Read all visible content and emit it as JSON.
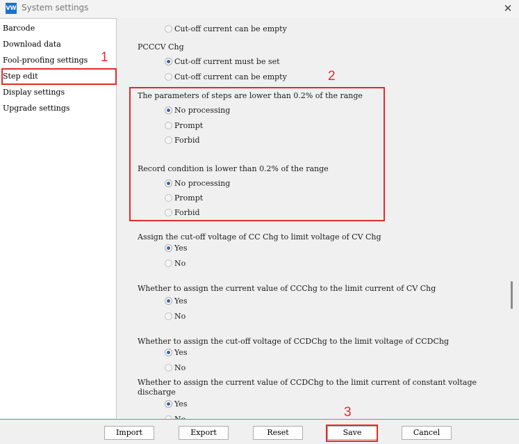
{
  "window": {
    "title": "System settings",
    "icon": "app-logo-icon",
    "close": "close-icon",
    "icon_text": "VW"
  },
  "sidebar": {
    "items": [
      {
        "label": "Barcode"
      },
      {
        "label": "Download data"
      },
      {
        "label": "Fool-proofing settings"
      },
      {
        "label": "Step edit",
        "selected": true
      },
      {
        "label": "Display settings"
      },
      {
        "label": "Upgrade settings"
      }
    ]
  },
  "content": {
    "top_option": "Cut-off current can be empty",
    "pcccv": {
      "heading": "PCCCV Chg",
      "options": [
        "Cut-off current must be set",
        "Cut-off current can be empty"
      ],
      "selected": 0
    },
    "steps_param": {
      "heading": "The parameters of steps are lower than 0.2% of the range",
      "options": [
        "No processing",
        "Prompt",
        "Forbid"
      ],
      "selected": 0
    },
    "record_condition": {
      "heading": "Record condition is lower than 0.2% of the range",
      "options": [
        "No processing",
        "Prompt",
        "Forbid"
      ],
      "selected": 0
    },
    "assign_cc": {
      "heading": "Assign the cut-off voltage of CC Chg to limit voltage of CV Chg",
      "options": [
        "Yes",
        "No"
      ],
      "selected": 0
    },
    "assign_ccchg": {
      "heading": "Whether to assign the current value of CCChg to the limit current of CV Chg",
      "options": [
        "Yes",
        "No"
      ],
      "selected": 0
    },
    "assign_ccdchg_voltage": {
      "heading": "Whether to assign the cut-off voltage of CCDChg to the limit voltage of CCDChg",
      "options": [
        "Yes",
        "No"
      ],
      "selected": 0
    },
    "assign_ccdchg_current": {
      "heading_line1": "Whether to assign the current value of CCDChg to the limit current of constant voltage",
      "heading_line2": "discharge",
      "options": [
        "Yes",
        "No"
      ],
      "selected": 0
    }
  },
  "buttons": {
    "import": "Import",
    "export": "Export",
    "reset": "Reset",
    "save": "Save",
    "cancel": "Cancel"
  },
  "annotations": {
    "mark1": "1",
    "mark2": "2",
    "mark3": "3"
  },
  "colors": {
    "highlight": "#e32a2a",
    "radio_selected": "#3b5fa8"
  }
}
